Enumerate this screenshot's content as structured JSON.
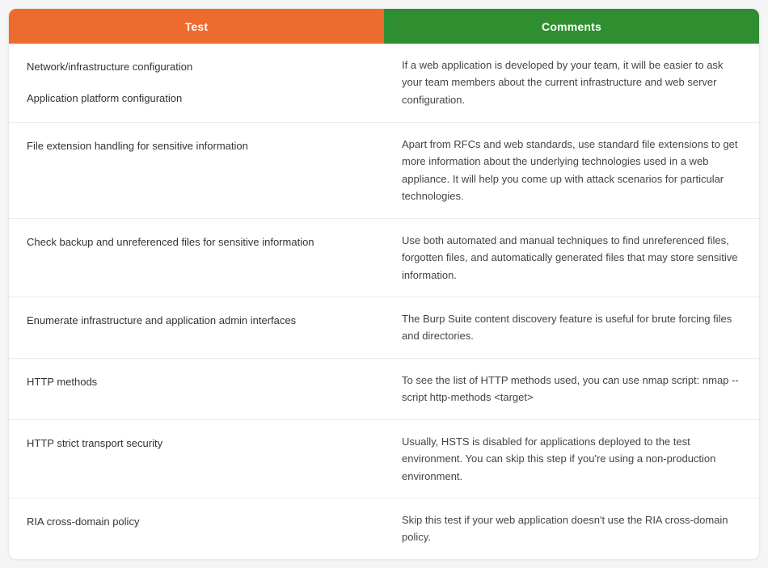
{
  "chart_data": {
    "type": "table",
    "columns": [
      "Test",
      "Comments"
    ],
    "rows": [
      {
        "tests": [
          "Network/infrastructure configuration",
          "Application platform configuration"
        ],
        "comment": "If a web application is developed by your team, it will be easier to ask your team members about the current infrastructure and web server configuration."
      },
      {
        "tests": [
          "File extension handling for sensitive information"
        ],
        "comment": "Apart from RFCs and web standards, use standard file extensions to get more information about the underlying technologies used in a web appliance. It will help you come up with attack scenarios for particular technologies."
      },
      {
        "tests": [
          "Check backup and unreferenced files for sensitive information"
        ],
        "comment": "Use both automated and manual techniques to find unreferenced files, forgotten files, and automatically generated files that may store sensitive information."
      },
      {
        "tests": [
          "Enumerate infrastructure and application admin interfaces"
        ],
        "comment": "The Burp Suite content discovery feature is useful for brute forcing files and directories."
      },
      {
        "tests": [
          "HTTP methods"
        ],
        "comment": "To see the list of HTTP methods used, you can use nmap script: nmap --script http-methods <target>"
      },
      {
        "tests": [
          "HTTP strict transport security"
        ],
        "comment": "Usually, HSTS is disabled for applications deployed to the test environment. You can skip this step if you're using a non-production environment."
      },
      {
        "tests": [
          "RIA cross-domain policy"
        ],
        "comment": "Skip this test if your web application doesn't use the RIA cross-domain policy."
      }
    ]
  },
  "header": {
    "test_label": "Test",
    "comments_label": "Comments"
  }
}
